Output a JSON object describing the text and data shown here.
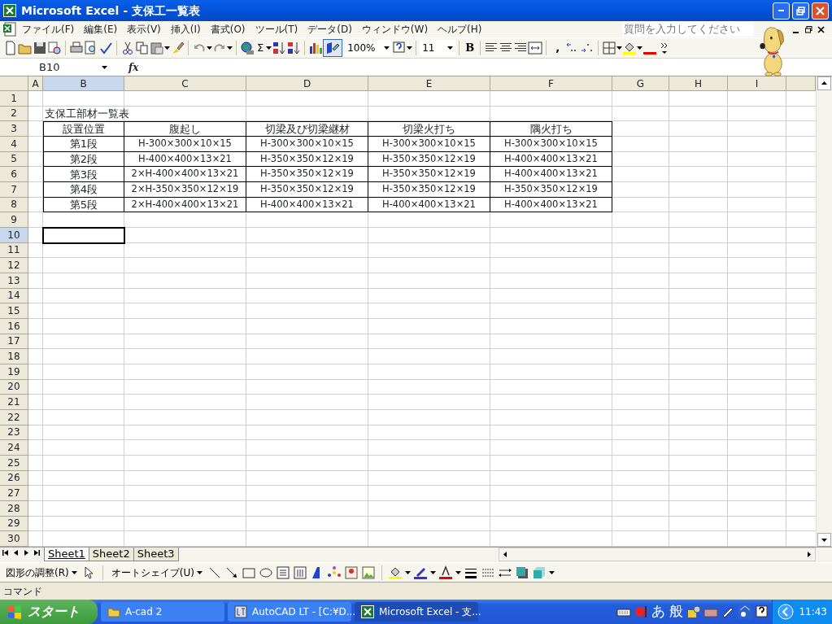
{
  "window": {
    "title": "Microsoft Excel - 支保工一覧表"
  },
  "menu": {
    "items": [
      "ファイル(F)",
      "編集(E)",
      "表示(V)",
      "挿入(I)",
      "書式(O)",
      "ツール(T)",
      "データ(D)",
      "ウィンドウ(W)",
      "ヘルプ(H)"
    ],
    "help_placeholder": "質問を入力してください"
  },
  "toolbar": {
    "autosum": "Σ",
    "zoom": "100%",
    "font_size": "11",
    "bold": "B",
    "comma": ","
  },
  "formula_bar": {
    "name_box": "B10",
    "fx": "fx"
  },
  "columns": [
    {
      "label": "A",
      "selected": false
    },
    {
      "label": "B",
      "selected": true
    },
    {
      "label": "C",
      "selected": false
    },
    {
      "label": "D",
      "selected": false
    },
    {
      "label": "E",
      "selected": false
    },
    {
      "label": "F",
      "selected": false
    },
    {
      "label": "G",
      "selected": false
    },
    {
      "label": "H",
      "selected": false
    },
    {
      "label": "I",
      "selected": false
    }
  ],
  "row_headers": [
    {
      "label": "1",
      "selected": false
    },
    {
      "label": "2",
      "selected": false
    },
    {
      "label": "3",
      "selected": false
    },
    {
      "label": "4",
      "selected": false
    },
    {
      "label": "5",
      "selected": false
    },
    {
      "label": "6",
      "selected": false
    },
    {
      "label": "7",
      "selected": false
    },
    {
      "label": "8",
      "selected": false
    },
    {
      "label": "9",
      "selected": false
    },
    {
      "label": "10",
      "selected": true
    },
    {
      "label": "11",
      "selected": false
    },
    {
      "label": "12",
      "selected": false
    },
    {
      "label": "13",
      "selected": false
    },
    {
      "label": "14",
      "selected": false
    },
    {
      "label": "15",
      "selected": false
    },
    {
      "label": "16",
      "selected": false
    },
    {
      "label": "17",
      "selected": false
    },
    {
      "label": "18",
      "selected": false
    },
    {
      "label": "19",
      "selected": false
    },
    {
      "label": "20",
      "selected": false
    },
    {
      "label": "21",
      "selected": false
    },
    {
      "label": "22",
      "selected": false
    },
    {
      "label": "23",
      "selected": false
    },
    {
      "label": "24",
      "selected": false
    },
    {
      "label": "25",
      "selected": false
    },
    {
      "label": "26",
      "selected": false
    },
    {
      "label": "27",
      "selected": false
    },
    {
      "label": "28",
      "selected": false
    },
    {
      "label": "29",
      "selected": false
    },
    {
      "label": "30",
      "selected": false
    }
  ],
  "sheet_title": "支保工部材一覧表",
  "table": {
    "columns": [
      "設置位置",
      "腹起し",
      "切梁及び切梁継材",
      "切梁火打ち",
      "隅火打ち"
    ],
    "rows": [
      [
        "第1段",
        "H-300×300×10×15",
        "H-300×300×10×15",
        "H-300×300×10×15",
        "H-300×300×10×15"
      ],
      [
        "第2段",
        "H-400×400×13×21",
        "H-350×350×12×19",
        "H-350×350×12×19",
        "H-400×400×13×21"
      ],
      [
        "第3段",
        "2×H-400×400×13×21",
        "H-350×350×12×19",
        "H-350×350×12×19",
        "H-400×400×13×21"
      ],
      [
        "第4段",
        "2×H-350×350×12×19",
        "H-350×350×12×19",
        "H-350×350×12×19",
        "H-350×350×12×19"
      ],
      [
        "第5段",
        "2×H-400×400×13×21",
        "H-400×400×13×21",
        "H-400×400×13×21",
        "H-400×400×13×21"
      ]
    ]
  },
  "sheet_tabs": [
    {
      "label": "Sheet1",
      "selected": true
    },
    {
      "label": "Sheet2",
      "selected": false
    },
    {
      "label": "Sheet3",
      "selected": false
    }
  ],
  "drawing_toolbar": {
    "draw_menu": "図形の調整(R)",
    "autoshape_menu": "オートシェイプ(U)"
  },
  "status_bar": "コマンド",
  "taskbar": {
    "start": "スタート",
    "tasks": [
      {
        "label": "A-cad 2",
        "kind": "folder",
        "selected": false
      },
      {
        "label": "AutoCAD LT - [C:¥D...",
        "kind": "autocad",
        "selected": false
      },
      {
        "label": "Microsoft Excel - 支...",
        "kind": "excel",
        "selected": true
      }
    ],
    "ime": [
      "あ",
      "般"
    ],
    "clock": "11:43"
  }
}
